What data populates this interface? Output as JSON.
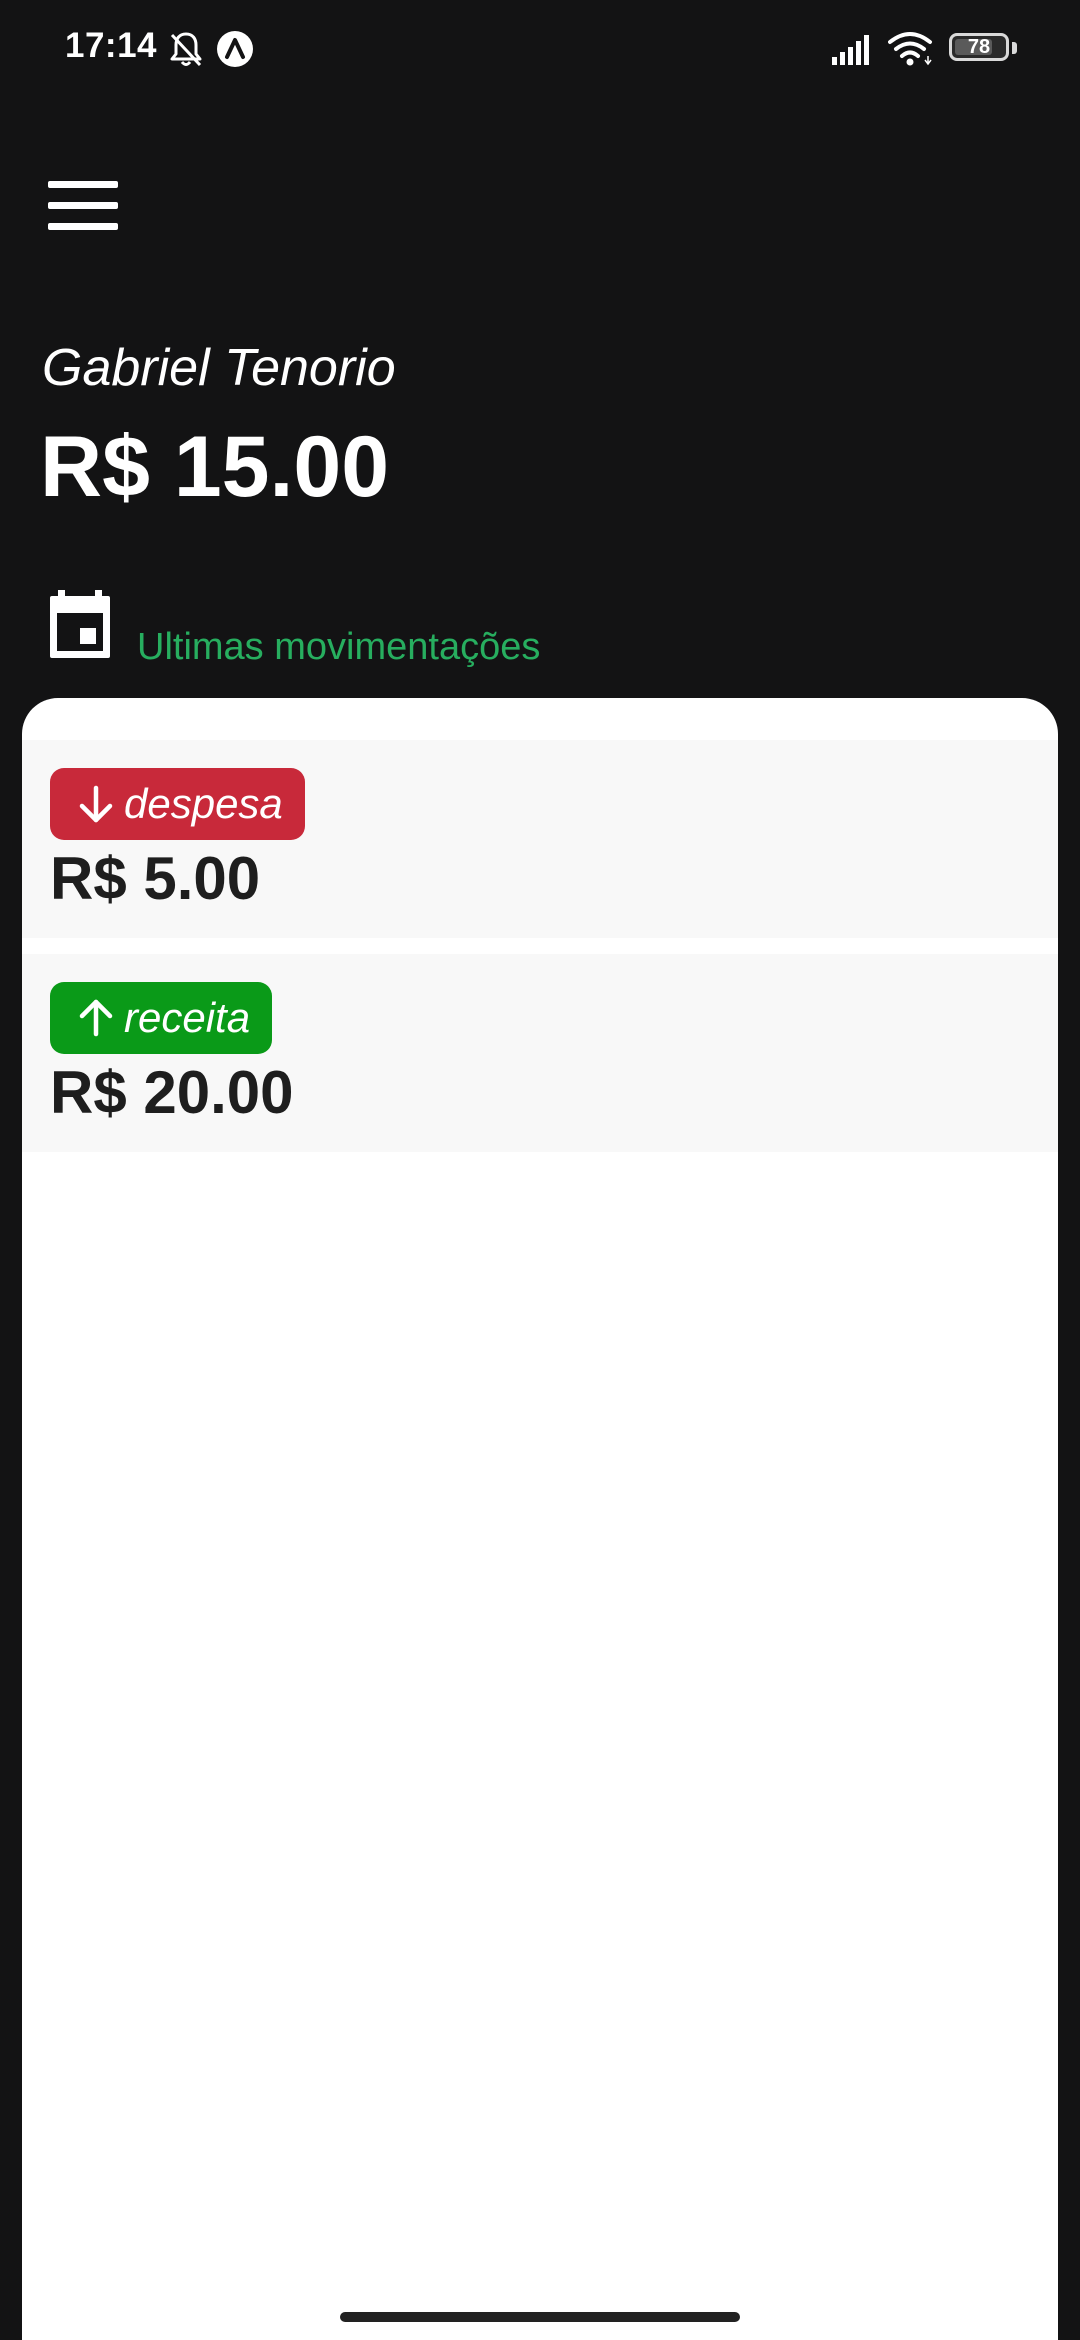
{
  "status_bar": {
    "time": "17:14",
    "battery_level": "78",
    "battery_percent": 78
  },
  "user": {
    "name": "Gabriel Tenorio",
    "balance": "R$ 15.00"
  },
  "section": {
    "title": "Ultimas movimentações"
  },
  "transactions": [
    {
      "type_label": "despesa",
      "direction": "down",
      "amount": "R$ 5.00",
      "badge_color": "#c8293a"
    },
    {
      "type_label": "receita",
      "direction": "up",
      "amount": "R$ 20.00",
      "badge_color": "#0a9a18"
    }
  ],
  "colors": {
    "background": "#131314",
    "accent_green": "#27ae5f",
    "card": "#ffffff",
    "row": "#f8f8f8"
  },
  "icons": {
    "menu": "menu-icon",
    "calendar": "calendar-icon",
    "expense": "arrow-down-icon",
    "income": "arrow-up-icon"
  }
}
